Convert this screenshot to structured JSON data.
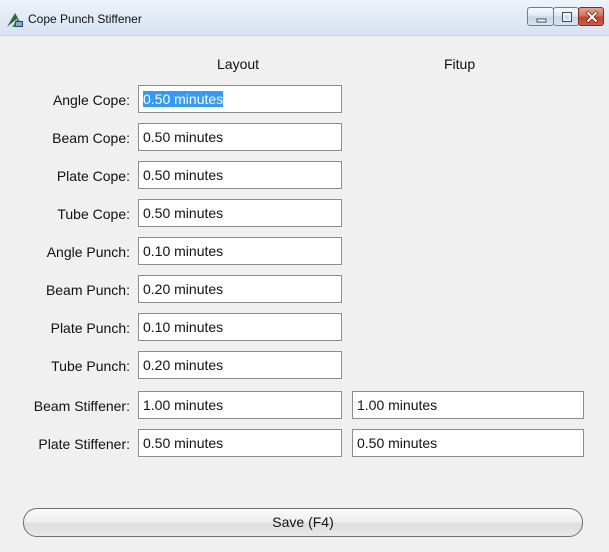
{
  "window": {
    "title": "Cope Punch Stiffener"
  },
  "columns": {
    "layout": "Layout",
    "fitup": "Fitup"
  },
  "rows": [
    {
      "label": "Angle Cope:",
      "layout": "0.50 minutes"
    },
    {
      "label": "Beam Cope:",
      "layout": "0.50 minutes"
    },
    {
      "label": "Plate Cope:",
      "layout": "0.50 minutes"
    },
    {
      "label": "Tube Cope:",
      "layout": "0.50 minutes"
    },
    {
      "label": "Angle Punch:",
      "layout": "0.10 minutes"
    },
    {
      "label": "Beam Punch:",
      "layout": "0.20 minutes"
    },
    {
      "label": "Plate Punch:",
      "layout": "0.10 minutes"
    },
    {
      "label": "Tube Punch:",
      "layout": "0.20 minutes"
    },
    {
      "label": "Beam Stiffener:",
      "layout": "1.00 minutes",
      "fitup": "1.00 minutes"
    },
    {
      "label": "Plate Stiffener:",
      "layout": "0.50 minutes",
      "fitup": "0.50 minutes"
    }
  ],
  "buttons": {
    "save": "Save (F4)"
  },
  "colors": {
    "selection": "#3399ff",
    "close_button": "#c4412b"
  }
}
